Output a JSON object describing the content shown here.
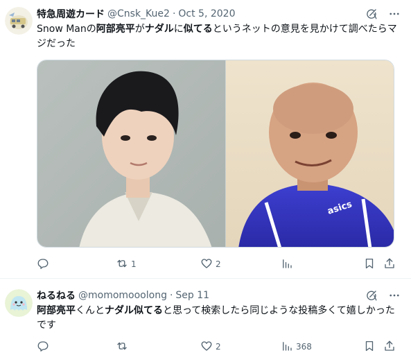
{
  "tweets": [
    {
      "name": "特急周遊カード",
      "handle": "@Cnsk_Kue2",
      "date": "Oct 5, 2020",
      "text": [
        {
          "t": "Snow Man",
          "b": false
        },
        {
          "t": "の",
          "b": false
        },
        {
          "t": "阿部亮平",
          "b": true
        },
        {
          "t": "が",
          "b": false
        },
        {
          "t": "ナダル",
          "b": true
        },
        {
          "t": "に",
          "b": false
        },
        {
          "t": "似てる",
          "b": true
        },
        {
          "t": "というネットの意見を見かけて調べたらマジだった",
          "b": false
        }
      ],
      "media_alt": "two-person comparison photo",
      "counts": {
        "reply": "",
        "retweet": "1",
        "like": "2",
        "views": ""
      }
    },
    {
      "name": "ねるねる",
      "handle": "@momomooolong",
      "date": "Sep 11",
      "text": [
        {
          "t": "阿部亮平",
          "b": true
        },
        {
          "t": "くんと",
          "b": false
        },
        {
          "t": "ナダル似てる",
          "b": true
        },
        {
          "t": "と思って検索したら同じような投稿多くて嬉しかったです",
          "b": false
        }
      ],
      "counts": {
        "reply": "",
        "retweet": "",
        "like": "2",
        "views": "368"
      }
    }
  ],
  "colors": {
    "text": "#0f1419",
    "secondary": "#536471",
    "border": "#eff3f4"
  },
  "icons": [
    "grok-icon",
    "more-icon",
    "reply-icon",
    "retweet-icon",
    "like-icon",
    "views-icon",
    "bookmark-icon",
    "share-icon"
  ]
}
